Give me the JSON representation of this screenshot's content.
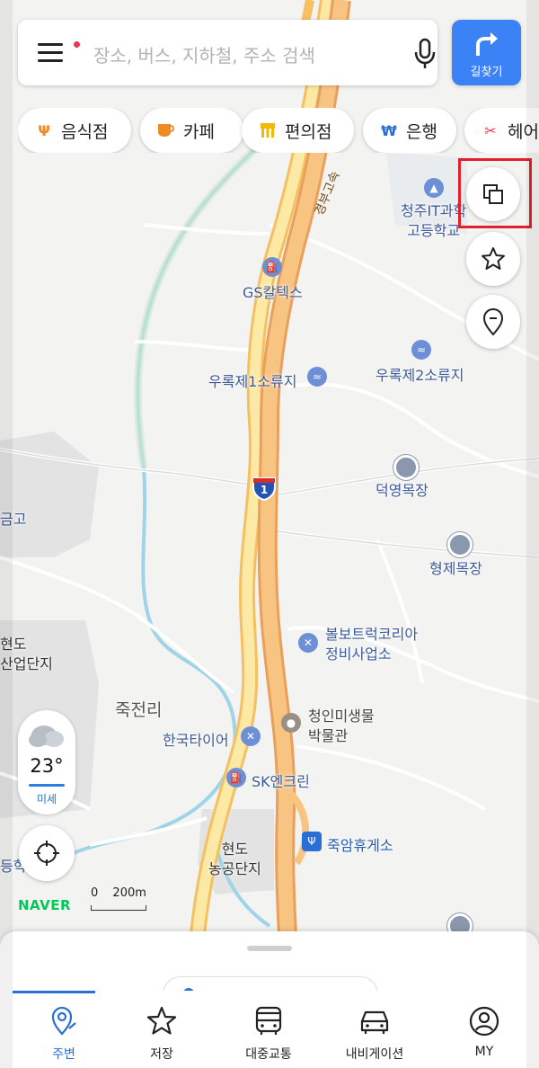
{
  "search": {
    "placeholder": "장소, 버스, 지하철, 주소 검색",
    "route_label": "길찾기"
  },
  "categories": [
    {
      "label": "음식점",
      "icon": "fork-knife-icon",
      "color": "#f08a24"
    },
    {
      "label": "카페",
      "icon": "coffee-cup-icon",
      "color": "#f08a24"
    },
    {
      "label": "편의점",
      "icon": "store-icon",
      "color": "#f5b800"
    },
    {
      "label": "은행",
      "icon": "won-icon",
      "color": "#2a6fd6"
    },
    {
      "label": "헤어",
      "icon": "scissors-icon",
      "color": "#e8384f"
    }
  ],
  "map_labels": {
    "highway_name": "경부고속",
    "highway_shield": "1",
    "school": "청주IT과학\n고등학교",
    "gas1": "GS칼텍스",
    "reservoir1": "우록제1소류지",
    "reservoir2": "우록제2소류지",
    "ranch1": "덕영목장",
    "ranch2": "형제목장",
    "repair": "볼보트럭코리아\n정비사업소",
    "village": "죽전리",
    "museum": "청인미생물\n박물관",
    "tire": "한국타이어",
    "gas2": "SK엔크린",
    "rest_area": "죽암휴게소",
    "complex": "현도\n농공단지",
    "left1": "금고",
    "left2": "현도\n산업단지",
    "left3": "등학"
  },
  "weather": {
    "temp": "23°",
    "dust": "미세"
  },
  "brand": "NAVER",
  "scale": "200m",
  "scale_zero": "0",
  "tabs": [
    {
      "label": "주변",
      "icon": "location-pin-icon",
      "active": true
    },
    {
      "label": "저장",
      "icon": "star-icon",
      "active": false
    },
    {
      "label": "대중교통",
      "icon": "bus-icon",
      "active": false
    },
    {
      "label": "내비게이션",
      "icon": "car-icon",
      "active": false
    },
    {
      "label": "MY",
      "icon": "profile-icon",
      "active": false
    }
  ],
  "colors": {
    "accent": "#2a6fd6",
    "route_button": "#3b82f6",
    "highlight": "#e0202a",
    "brand_green": "#03c75a"
  }
}
